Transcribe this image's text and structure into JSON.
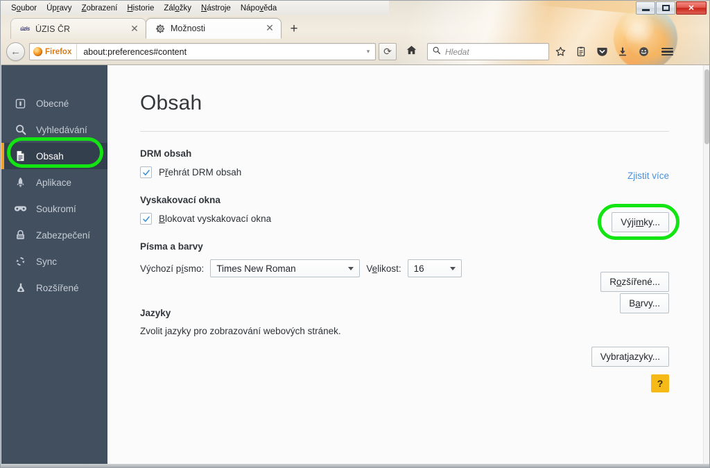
{
  "window": {
    "controls": {
      "minimize": "minimize-button",
      "maximize": "maximize-button",
      "close": "✕"
    }
  },
  "menubar": {
    "items": [
      {
        "label": "Soubor",
        "pre": "S",
        "key": "o",
        "post": "ubor"
      },
      {
        "label": "Úpravy",
        "pre": "Úp",
        "key": "r",
        "post": "avy"
      },
      {
        "label": "Zobrazení",
        "pre": "",
        "key": "Z",
        "post": "obrazení"
      },
      {
        "label": "Historie",
        "pre": "",
        "key": "H",
        "post": "istorie"
      },
      {
        "label": "Záložky",
        "pre": "Zál",
        "key": "o",
        "post": "žky"
      },
      {
        "label": "Nástroje",
        "pre": "",
        "key": "N",
        "post": "ástroje"
      },
      {
        "label": "Nápověda",
        "pre": "Nápo",
        "key": "v",
        "post": "ěda"
      }
    ]
  },
  "tabs": {
    "items": [
      {
        "title": "ÚZIS ČR",
        "favicon": "uzis-favicon",
        "favicon_text": "úzis",
        "active": false,
        "close": "✕"
      },
      {
        "title": "Možnosti",
        "favicon": "gear-icon",
        "favicon_text": "",
        "active": true,
        "close": "✕"
      }
    ],
    "new_tab_label": "+"
  },
  "toolbar": {
    "back_label": "←",
    "identity_label": "Firefox",
    "url": "about:preferences#content",
    "url_dropdown": "▾",
    "reload_label": "⟳",
    "home_label": "home-icon",
    "search_placeholder": "Hledat",
    "search_value": "",
    "icons": [
      "bookmark-star-icon",
      "library-icon",
      "pocket-icon",
      "downloads-icon",
      "smiley-icon",
      "menu-hamburger-icon"
    ]
  },
  "sidebar": {
    "items": [
      {
        "label": "Obecné",
        "icon": "general-icon",
        "selected": false
      },
      {
        "label": "Vyhledávání",
        "icon": "search-icon",
        "selected": false
      },
      {
        "label": "Obsah",
        "icon": "content-icon",
        "selected": true
      },
      {
        "label": "Aplikace",
        "icon": "rocket-icon",
        "selected": false
      },
      {
        "label": "Soukromí",
        "icon": "mask-icon",
        "selected": false
      },
      {
        "label": "Zabezpečení",
        "icon": "lock-icon",
        "selected": false
      },
      {
        "label": "Sync",
        "icon": "sync-icon",
        "selected": false
      },
      {
        "label": "Rozšířené",
        "icon": "flask-icon",
        "selected": false
      }
    ]
  },
  "main": {
    "title": "Obsah",
    "drm": {
      "heading": "DRM obsah",
      "checkbox_label_pre": "P",
      "checkbox_label_key": "ř",
      "checkbox_label_post": "ehrát DRM obsah",
      "checkbox_checked": true,
      "learn_more": "Zjistit více"
    },
    "popups": {
      "heading": "Vyskakovací okna",
      "checkbox_label_pre": "",
      "checkbox_label_key": "B",
      "checkbox_label_post": "lokovat vyskakovací okna",
      "checkbox_checked": true,
      "exceptions_button_pre": "Výji",
      "exceptions_button_key": "m",
      "exceptions_button_post": "ky..."
    },
    "fonts": {
      "heading": "Písma a barvy",
      "font_label_pre": "Výchozí p",
      "font_label_key": "í",
      "font_label_post": "smo:",
      "font_value": "Times New Roman",
      "size_label_pre": "V",
      "size_label_key": "e",
      "size_label_post": "likost:",
      "size_value": "16",
      "advanced_button_pre": "R",
      "advanced_button_key": "o",
      "advanced_button_post": "zšířené...",
      "colors_button_pre": "B",
      "colors_button_key": "a",
      "colors_button_post": "rvy..."
    },
    "languages": {
      "heading": "Jazyky",
      "description": "Zvolit jazyky pro zobrazování webových stránek.",
      "button_pre": "Vybrat ",
      "button_key": "j",
      "button_post": "azyky..."
    },
    "help_button": "?"
  },
  "colors": {
    "sidebar_bg": "#424f5e",
    "sidebar_selected_bg": "#333f4c",
    "sidebar_accent": "#f0a030",
    "highlight_green": "#12e512",
    "link_blue": "#4a90d9",
    "help_yellow": "#f5ba18",
    "content_bg": "#fbfbfb"
  }
}
